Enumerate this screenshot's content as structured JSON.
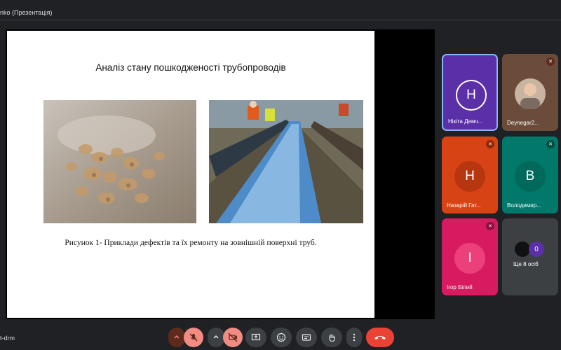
{
  "window": {
    "title": "nko (Презентація)"
  },
  "slide": {
    "title": "Аналіз стану пошкодженості трубопроводів",
    "caption": "Рисунок 1- Приклади дефектів та  їх ремонту на зовнішній поверхні труб."
  },
  "participants": [
    {
      "initial": "Н",
      "name": "Нікіта Демч...",
      "color": "#5b2fa8"
    },
    {
      "initial": "",
      "name": "Deynegar2...",
      "color": "#6b4b3a"
    },
    {
      "initial": "Н",
      "name": "Назарій Гат...",
      "color": "#d84315"
    },
    {
      "initial": "В",
      "name": "Володимир...",
      "color": "#00796b"
    },
    {
      "initial": "І",
      "name": "Ігор Білий",
      "color": "#d81b60"
    },
    {
      "initial": "",
      "name": "Ще 8 осіб",
      "color": "#3c4043"
    }
  ],
  "more": {
    "count": "0"
  },
  "meeting": {
    "code": "t-drm"
  },
  "colors": {
    "end_call": "#ea4335",
    "muted_red": "#f28b82"
  }
}
